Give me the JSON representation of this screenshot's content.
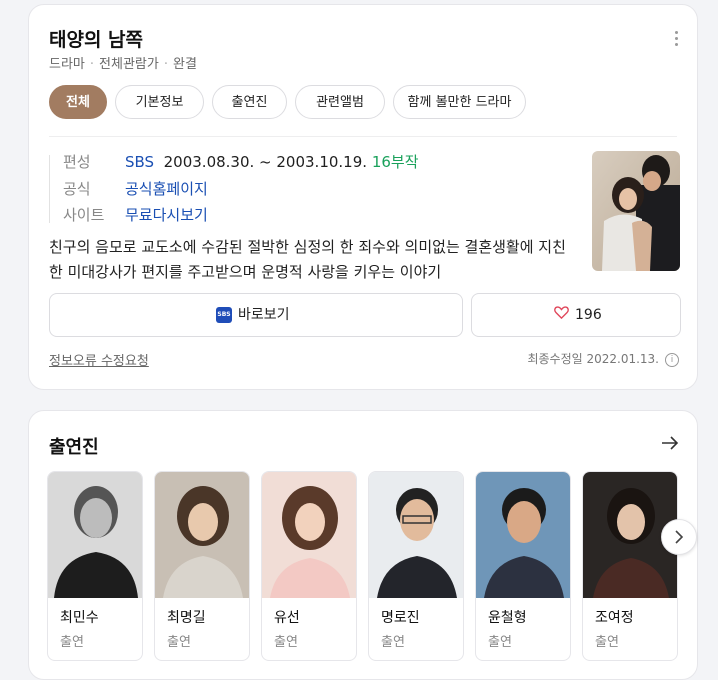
{
  "drama": {
    "title": "태양의 남쪽",
    "genre": "드라마",
    "rating": "전체관람가",
    "status": "완결"
  },
  "tabs": [
    "전체",
    "기본정보",
    "출연진",
    "관련앨범",
    "함께 볼만한 드라마"
  ],
  "info": {
    "broadcast_label": "편성",
    "channel": "SBS",
    "dates": "2003.08.30. ~ 2003.10.19.",
    "episodes": "16부작",
    "official_label": "공식",
    "official_link": "공식홈페이지",
    "site_label": "사이트",
    "site_link": "무료다시보기"
  },
  "description": "친구의 음모로 교도소에 수감된 절박한 심정의 한 죄수와 의미없는 결혼생활에 지친 한 미대강사가 편지를 주고받으며 운명적 사랑을 키우는 이야기",
  "buttons": {
    "watch_logo": "SBS",
    "watch_label": "바로보기",
    "like_count": "196"
  },
  "footer": {
    "report": "정보오류 수정요청",
    "updated": "최종수정일 2022.01.13."
  },
  "cast_section": {
    "title": "출연진",
    "members": [
      {
        "name": "최민수",
        "role": "출연"
      },
      {
        "name": "최명길",
        "role": "출연"
      },
      {
        "name": "유선",
        "role": "출연"
      },
      {
        "name": "명로진",
        "role": "출연"
      },
      {
        "name": "윤철형",
        "role": "출연"
      },
      {
        "name": "조여정",
        "role": "출연"
      }
    ]
  },
  "colors": {
    "active_tab": "#a27c61",
    "link_blue": "#1a4fb3",
    "episodes_green": "#1aa15b",
    "sbs_logo": "#1f4db8",
    "heart": "#e0475b"
  },
  "icons": [
    "more-vertical-icon",
    "sbs-logo-icon",
    "heart-icon",
    "info-icon",
    "arrow-right-icon",
    "chevron-right-icon"
  ]
}
